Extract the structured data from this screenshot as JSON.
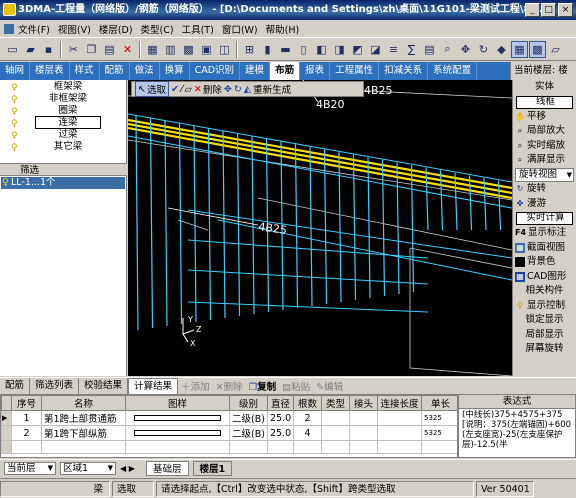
{
  "window": {
    "title": "3DMA-工程量（网络版）/钢筋（网络版） - [D:\\Documents and Settings\\zh\\桌面\\11G101-梁测试工程\\8..."
  },
  "menu": [
    "文件(F)",
    "视图(V)",
    "楼层(D)",
    "类型(C)",
    "工具(T)",
    "窗口(W)",
    "帮助(H)"
  ],
  "module_tabs": [
    "轴网",
    "楼层表",
    "样式",
    "配筋",
    "做法",
    "换算",
    "CAD识别",
    "建模",
    "布筋",
    "报表",
    "工程属性",
    "扣减关系",
    "系统配置"
  ],
  "active_module_tab": "布筋",
  "current_floor_label": "当前楼层: 楼",
  "left_tree": {
    "items": [
      "框架梁",
      "非框架梁",
      "圈梁",
      "连梁",
      "过梁",
      "其它梁"
    ],
    "selected": "连梁",
    "filter_label": "筛选",
    "element": "LL-1...1个"
  },
  "canvas_toolbar": {
    "select": "选取",
    "delete": "删除",
    "regenerate": "重新生成"
  },
  "canvas_labels": {
    "rebar_a": "4B25",
    "rebar_b": "4B20",
    "rebar_c": "4B25",
    "axis_x": "X",
    "axis_y": "Y",
    "axis_z": "Z"
  },
  "right_panel": {
    "items": [
      "实体",
      "线框",
      "平移",
      "局部放大",
      "实时缩放",
      "满屏显示",
      "旋转视图",
      "旋转",
      "漫游",
      "实时计算",
      "显示标注",
      "截面视图",
      "背景色",
      "CAD图形",
      "相关构件",
      "显示控制",
      "锁定显示",
      "局部显示",
      "屏幕旋转"
    ],
    "f4_label": "F4"
  },
  "bottom_tabs": {
    "tabs": [
      "配筋",
      "筛选列表",
      "校验结果",
      "计算结果"
    ],
    "active": "计算结果",
    "tools": [
      "添加",
      "删除",
      "复制",
      "粘贴",
      "编辑"
    ]
  },
  "results_table": {
    "columns": [
      "序号",
      "名称",
      "图样",
      "级别",
      "直径",
      "根数",
      "类型",
      "接头",
      "连接长度",
      "单长"
    ],
    "rows": [
      {
        "no": "1",
        "name": "第1跨上部贯通筋",
        "grade": "二级(B)",
        "dia": "25.0",
        "count": "2",
        "type": "",
        "joint": "",
        "conn": "",
        "len": "5325"
      },
      {
        "no": "2",
        "name": "第1跨下部纵筋",
        "grade": "二级(B)",
        "dia": "25.0",
        "count": "4",
        "type": "",
        "joint": "",
        "conn": "",
        "len": "5325"
      }
    ]
  },
  "formula": {
    "header": "表达式",
    "text": "(中线长)375+4575+375[说明：375(左端锚固)+600(左支座宽)-25(左支座保护层)-12.5(半"
  },
  "floor_bar": {
    "floor_label": "当前层",
    "region_label": "区域1",
    "floor_tabs": [
      "基础层",
      "楼层1"
    ],
    "active_floor": "楼层1"
  },
  "statusbar": {
    "object": "梁",
    "mode": "选取",
    "hint": "请选择起点,【Ctrl】改变选中状态,【Shift】跨类型选取",
    "version": "Ver 50401"
  },
  "colors": {
    "title_bg": "#0a246a",
    "tab_bg": "#2e6fbe",
    "canvas_bg": "#000000",
    "rebar_cyan": "#39d0ff",
    "rebar_yellow": "#ffe000"
  }
}
